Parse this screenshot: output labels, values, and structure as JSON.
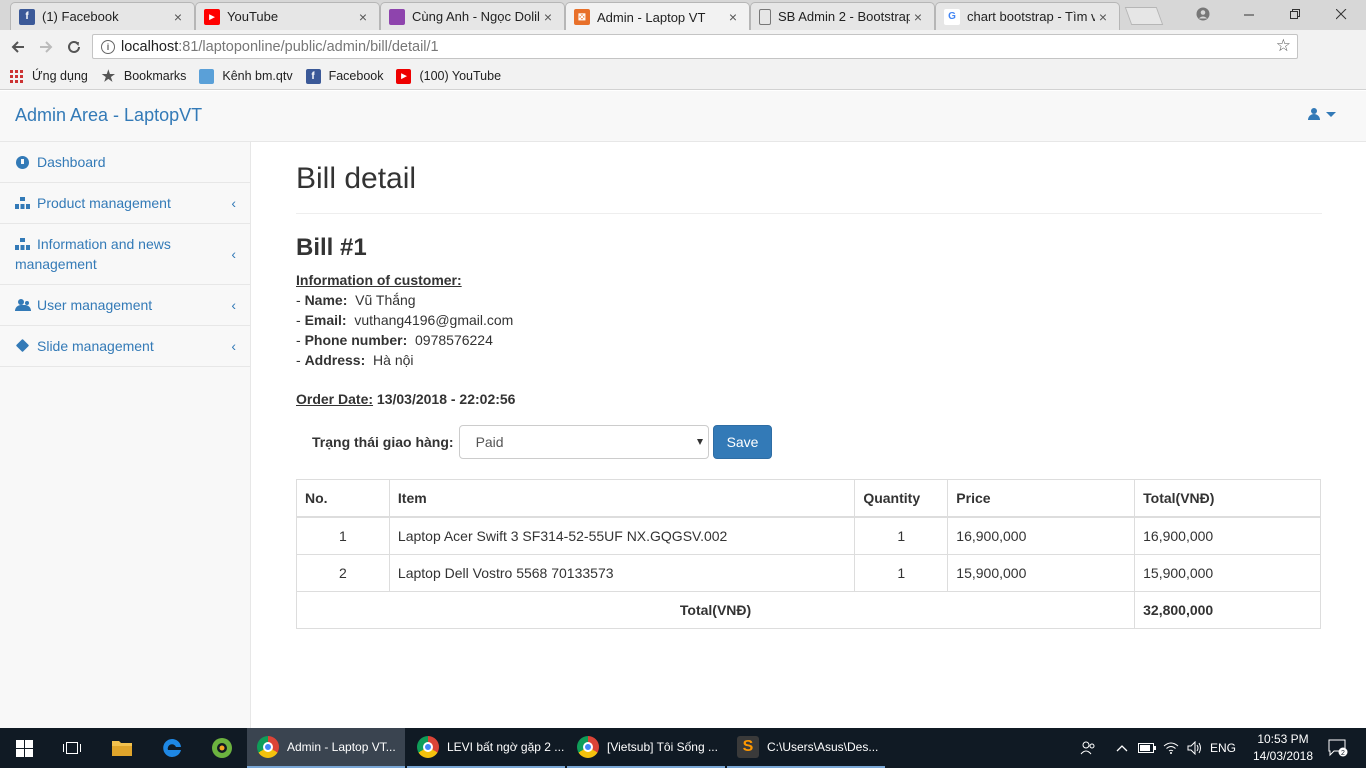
{
  "browser": {
    "tabs": [
      {
        "title": "(1) Facebook",
        "favicon": "facebook-icon",
        "color": "#3b5998",
        "active": false
      },
      {
        "title": "YouTube",
        "favicon": "youtube-icon",
        "color": "#ff0000",
        "active": false
      },
      {
        "title": "Cùng Anh - Ngọc Dolil,",
        "favicon": "music-icon",
        "color": "#8e44ad",
        "active": false
      },
      {
        "title": "Admin - Laptop VT",
        "favicon": "xampp-icon",
        "color": "#e8702a",
        "active": true
      },
      {
        "title": "SB Admin 2 - Bootstrap",
        "favicon": "document-icon",
        "color": "#888888",
        "active": false
      },
      {
        "title": "chart bootstrap - Tìm v",
        "favicon": "google-icon",
        "color": "#4285f4",
        "active": false
      }
    ],
    "url_host": "localhost",
    "url_rest": ":81/laptoponline/public/admin/bill/detail/1",
    "bookmarks": [
      {
        "label": "Ứng dụng",
        "icon": "apps-icon"
      },
      {
        "label": "Bookmarks",
        "icon": "star-icon"
      },
      {
        "label": "Kênh bm.qtv",
        "icon": "cloud-icon"
      },
      {
        "label": "Facebook",
        "icon": "facebook-icon"
      },
      {
        "label": "(100) YouTube",
        "icon": "youtube-icon"
      }
    ]
  },
  "app": {
    "brand": "Admin Area - LaptopVT",
    "sidebar": [
      {
        "label": "Dashboard",
        "icon": "dashboard-icon",
        "has_arrow": false
      },
      {
        "label": "Product management",
        "icon": "sitemap-icon",
        "has_arrow": true
      },
      {
        "label": "Information and news management",
        "icon": "sitemap-icon",
        "has_arrow": true
      },
      {
        "label": "User management",
        "icon": "users-icon",
        "has_arrow": true
      },
      {
        "label": "Slide management",
        "icon": "cube-icon",
        "has_arrow": true
      }
    ],
    "arrow_glyph": "‹"
  },
  "bill": {
    "page_title": "Bill detail",
    "bill_title": "Bill #1",
    "customer_heading": "Information of customer:",
    "name_label": "Name:",
    "name": "Vũ Thắng",
    "email_label": "Email:",
    "email": "vuthang4196@gmail.com",
    "phone_label": "Phone number:",
    "phone": "0978576224",
    "address_label": "Address:",
    "address": "Hà nội",
    "order_date_label": "Order Date:",
    "order_date": "13/03/2018 - 22:02:56",
    "status_label": "Trạng thái giao hàng:",
    "status_value": "Paid",
    "save_label": "Save",
    "table": {
      "headers": [
        "No.",
        "Item",
        "Quantity",
        "Price",
        "Total(VNĐ)"
      ],
      "rows": [
        {
          "no": "1",
          "item": "Laptop Acer Swift 3 SF314-52-55UF NX.GQGSV.002",
          "qty": "1",
          "price": "16,900,000",
          "total": "16,900,000"
        },
        {
          "no": "2",
          "item": "Laptop Dell Vostro 5568 70133573",
          "qty": "1",
          "price": "15,900,000",
          "total": "15,900,000"
        }
      ],
      "footer_label": "Total(VNĐ)",
      "footer_total": "32,800,000"
    }
  },
  "taskbar": {
    "tasks": [
      {
        "label": "Admin - Laptop VT...",
        "icon": "chrome-icon",
        "active": true
      },
      {
        "label": "LEVI bất ngờ gặp 2 ...",
        "icon": "chrome-icon",
        "active": false
      },
      {
        "label": "[Vietsub] Tôi Sống ...",
        "icon": "chrome-icon",
        "active": false
      },
      {
        "label": "C:\\Users\\Asus\\Des...",
        "icon": "sublime-icon",
        "active": false
      }
    ],
    "lang": "ENG",
    "time": "10:53 PM",
    "date": "14/03/2018",
    "notifications": "2"
  }
}
